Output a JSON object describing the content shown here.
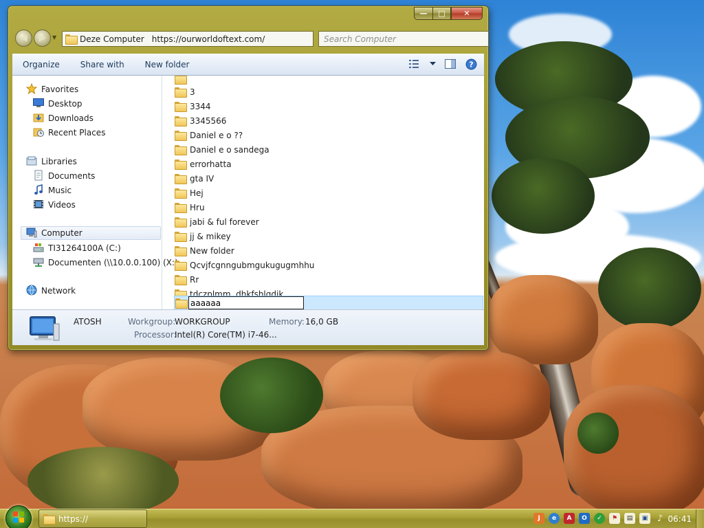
{
  "window": {
    "address_crumb": "Deze Computer",
    "address_url": "https://ourworldoftext.com/",
    "search_placeholder": "Search Computer"
  },
  "toolbar": {
    "organize": "Organize",
    "share_with": "Share with",
    "new_folder": "New folder"
  },
  "nav_pane": {
    "favorites": "Favorites",
    "favorites_items": [
      "Desktop",
      "Downloads",
      "Recent Places"
    ],
    "libraries": "Libraries",
    "libraries_items": [
      "Documents",
      "Music",
      "Videos"
    ],
    "computer": "Computer",
    "computer_items": [
      "TI31264100A (C:)",
      "Documenten (\\\\10.0.0.100) (X:)"
    ],
    "network": "Network"
  },
  "file_list": {
    "folders": [
      "3",
      "3344",
      "3345566",
      "Daniel e o ??",
      "Daniel e o sandega",
      "errorhatta",
      "gta IV",
      "Hej",
      "Hru",
      "jabi & ful forever",
      "jj & mikey",
      "New folder",
      "Qcvjfcgnngubmgukugugmhhu",
      "Rr",
      "tdczplmm, dhkfshlgdjk"
    ],
    "renaming_value": "aaaaaa"
  },
  "details": {
    "computer_name": "ATOSH",
    "workgroup_label": "Workgroup:",
    "workgroup_value": "WORKGROUP",
    "memory_label": "Memory:",
    "memory_value": "16,0 GB",
    "processor_label": "Processor:",
    "processor_value": "Intel(R) Core(TM) i7-46..."
  },
  "taskbar": {
    "task_label": "https://",
    "clock": "06:41",
    "tray_icons": [
      "java-icon",
      "network-globe-icon",
      "pdf-icon",
      "outlook-icon",
      "security-check-icon",
      "flag-icon",
      "clipboard-icon",
      "monitor-icon",
      "volume-icon"
    ]
  },
  "colors": {
    "window_frame": "#a8a03a",
    "selection": "#cce8ff",
    "command_text": "#1e395b"
  }
}
